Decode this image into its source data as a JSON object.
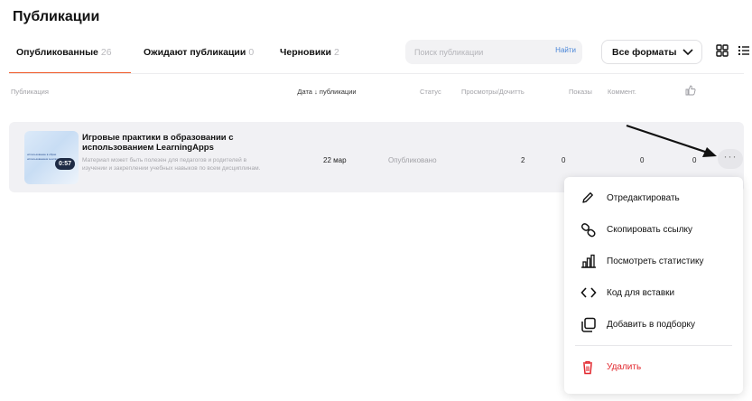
{
  "page": {
    "title": "Публикации"
  },
  "tabs": [
    {
      "label": "Опубликованные",
      "count": "26"
    },
    {
      "label": "Ожидают публикации",
      "count": "0"
    },
    {
      "label": "Черновики",
      "count": "2"
    }
  ],
  "search": {
    "placeholder": "Поиск публикации",
    "button_label": "Найти"
  },
  "format_filter": {
    "selected": "Все форматы"
  },
  "table": {
    "headers": {
      "publication": "Публикация",
      "date": "Дата ↓ публикации",
      "status": "Статус",
      "views_rate": "Просмотры/Дочитть",
      "impressions": "Показы",
      "comments": "Коммент."
    },
    "rows": [
      {
        "thumbnail_text_1": "использование в образ",
        "thumbnail_text_2": "использованием Learning",
        "duration": "0:57",
        "title": "Игровые практики в образовании с использованием LearningApps",
        "description": "Материал может быть полезен для педагогов и родителей в изучении и закреплении учебных навыков по всем дисциплинам.",
        "date": "22 мар",
        "status": "Опубликовано",
        "views": "2",
        "impressions": "0",
        "comments": "0",
        "likes": "0",
        "more": "···"
      }
    ]
  },
  "context_menu": {
    "items": [
      {
        "label": "Отредактировать",
        "icon": "pencil-icon"
      },
      {
        "label": "Скопировать ссылку",
        "icon": "link-icon"
      },
      {
        "label": "Посмотреть статистику",
        "icon": "stats-icon"
      },
      {
        "label": "Код для вставки",
        "icon": "code-icon"
      },
      {
        "label": "Добавить в подборку",
        "icon": "collection-icon"
      }
    ],
    "delete_label": "Удалить"
  },
  "colors": {
    "accent": "#f05a28",
    "danger": "#e2272e",
    "link": "#4a86d8"
  }
}
